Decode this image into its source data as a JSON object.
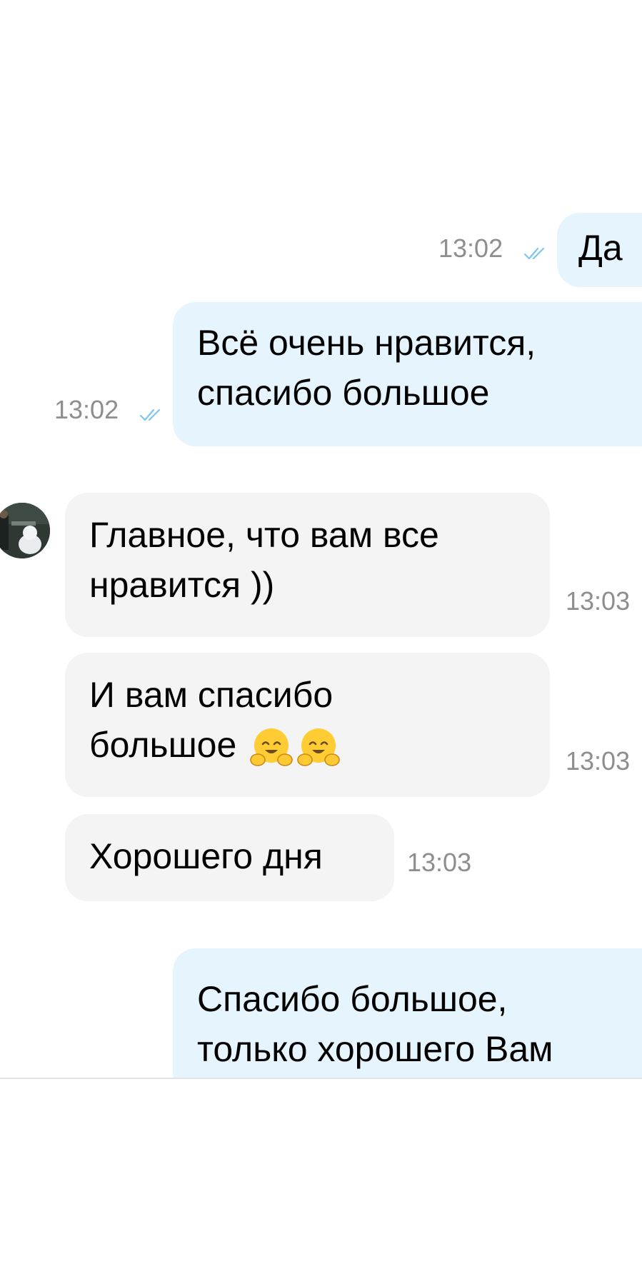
{
  "colors": {
    "outgoing_bubble": "#e6f4fd",
    "incoming_bubble": "#f4f4f4",
    "time_text": "#8e8e8e",
    "read_ticks": "#7cc6ef"
  },
  "messages": [
    {
      "direction": "outgoing",
      "lines": [
        "Да"
      ],
      "time": "13:02",
      "status_icon": "double-check-icon"
    },
    {
      "direction": "outgoing",
      "lines": [
        "Всё очень нравится,",
        "спасибо большое"
      ],
      "time": "13:02",
      "status_icon": "double-check-icon"
    },
    {
      "direction": "incoming",
      "lines": [
        "Главное, что вам все",
        "нравится ))"
      ],
      "time": "13:03",
      "avatar_icon": "contact-avatar"
    },
    {
      "direction": "incoming",
      "lines": [
        "И вам спасибо",
        "большое"
      ],
      "emoji": [
        "hugging-face-emoji",
        "hugging-face-emoji"
      ],
      "time": "13:03"
    },
    {
      "direction": "incoming",
      "lines": [
        "Хорошего дня"
      ],
      "time": "13:03"
    },
    {
      "direction": "outgoing",
      "lines": [
        "Спасибо большое,",
        "только хорошего Вам"
      ]
    }
  ]
}
